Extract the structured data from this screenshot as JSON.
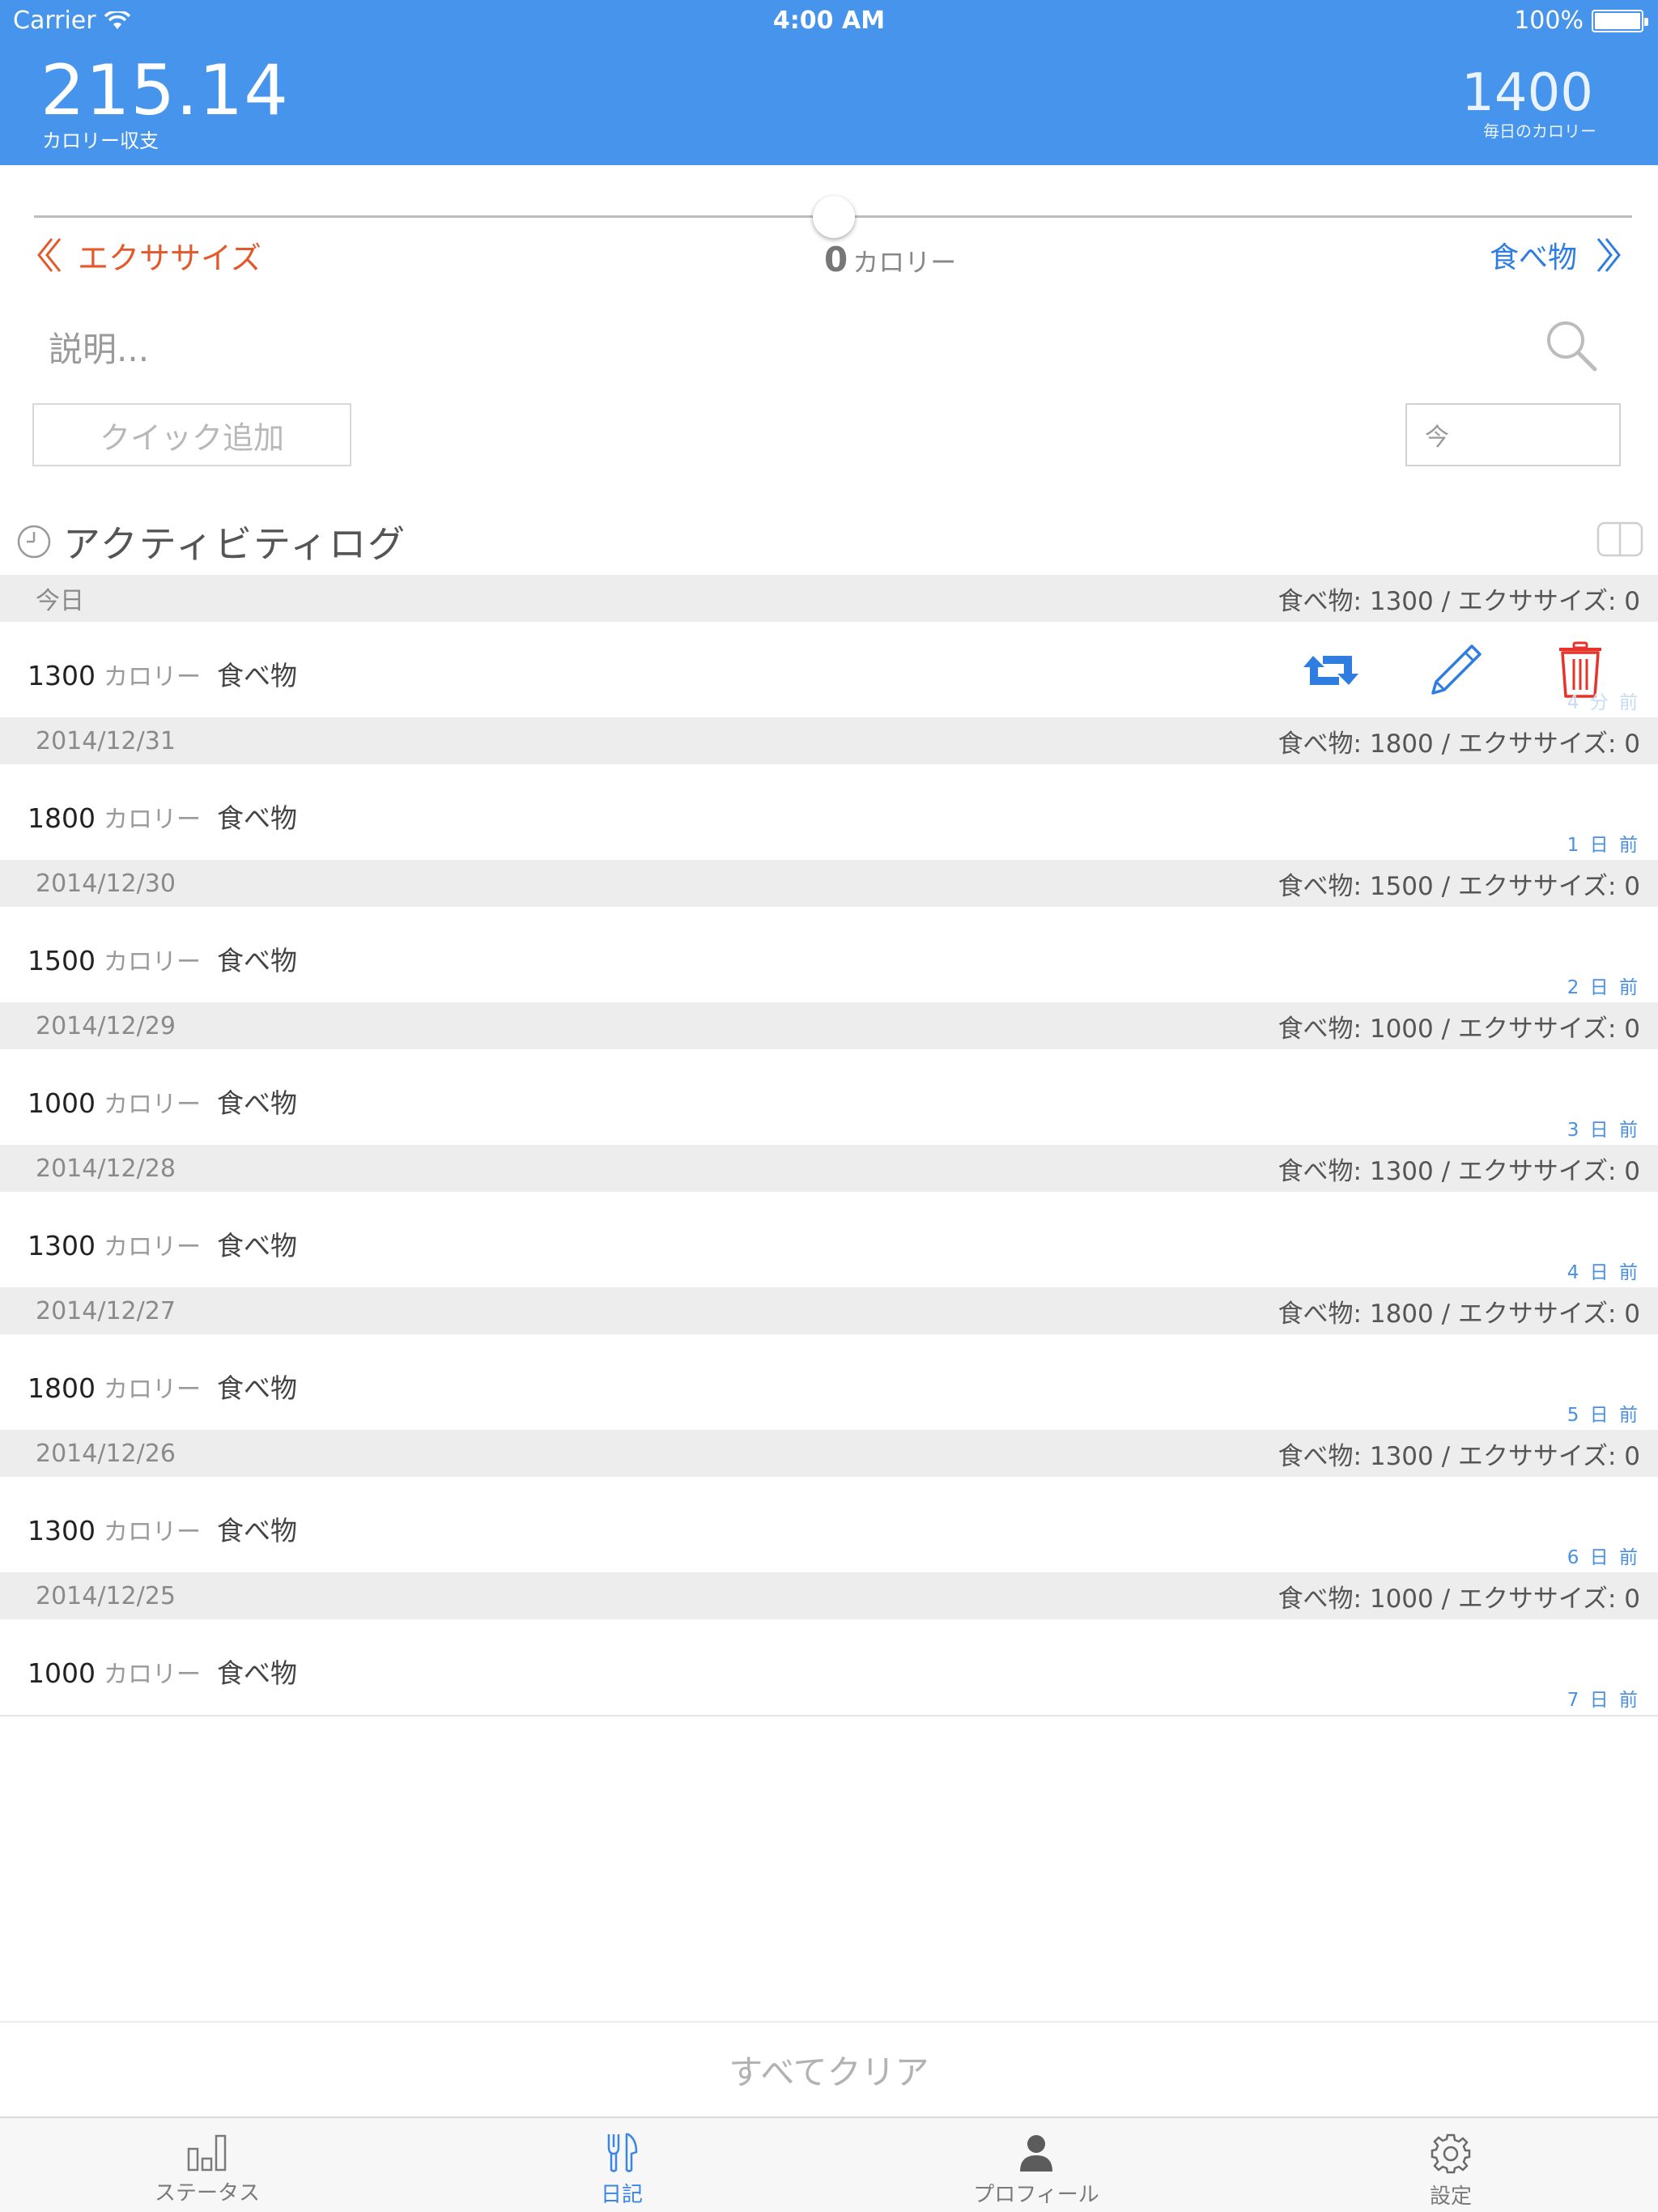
{
  "status_bar": {
    "carrier": "Carrier",
    "time": "4:00 AM",
    "battery": "100%"
  },
  "header": {
    "balance_value": "215.14",
    "balance_label": "カロリー収支",
    "daily_value": "1400",
    "daily_label": "毎日のカロリー",
    "background_color": "#4694ec"
  },
  "slider": {
    "left_label": "エクササイズ",
    "right_label": "食べ物",
    "calories_value": "0",
    "calories_unit": "カロリー",
    "left_color": "#e4582b",
    "right_color": "#2f7de1"
  },
  "search": {
    "placeholder": "説明...",
    "icon": "search-icon"
  },
  "quick_add": {
    "label": "クイック追加"
  },
  "time_field": {
    "placeholder": "今"
  },
  "activity_log": {
    "title": "アクティビティログ",
    "days": [
      {
        "date": "今日",
        "summary": "食べ物: 1300 / エクササイズ: 0",
        "entry": {
          "value": "1300",
          "unit": "カロリー",
          "type": "食べ物",
          "ago": "4 分 前"
        }
      },
      {
        "date": "2014/12/31",
        "summary": "食べ物: 1800 / エクササイズ: 0",
        "entry": {
          "value": "1800",
          "unit": "カロリー",
          "type": "食べ物",
          "ago": "1 日 前"
        }
      },
      {
        "date": "2014/12/30",
        "summary": "食べ物: 1500 / エクササイズ: 0",
        "entry": {
          "value": "1500",
          "unit": "カロリー",
          "type": "食べ物",
          "ago": "2 日 前"
        }
      },
      {
        "date": "2014/12/29",
        "summary": "食べ物: 1000 / エクササイズ: 0",
        "entry": {
          "value": "1000",
          "unit": "カロリー",
          "type": "食べ物",
          "ago": "3 日 前"
        }
      },
      {
        "date": "2014/12/28",
        "summary": "食べ物: 1300 / エクササイズ: 0",
        "entry": {
          "value": "1300",
          "unit": "カロリー",
          "type": "食べ物",
          "ago": "4 日 前"
        }
      },
      {
        "date": "2014/12/27",
        "summary": "食べ物: 1800 / エクササイズ: 0",
        "entry": {
          "value": "1800",
          "unit": "カロリー",
          "type": "食べ物",
          "ago": "5 日 前"
        }
      },
      {
        "date": "2014/12/26",
        "summary": "食べ物: 1300 / エクササイズ: 0",
        "entry": {
          "value": "1300",
          "unit": "カロリー",
          "type": "食べ物",
          "ago": "6 日 前"
        }
      },
      {
        "date": "2014/12/25",
        "summary": "食べ物: 1000 / エクササイズ: 0",
        "entry": {
          "value": "1000",
          "unit": "カロリー",
          "type": "食べ物",
          "ago": "7 日 前"
        }
      }
    ],
    "actions": {
      "repeat_icon": "repeat-icon",
      "edit_icon": "pencil-icon",
      "delete_icon": "trash-icon",
      "delete_color": "#e8322c",
      "accent_color": "#2f7de1"
    }
  },
  "clear_all": {
    "label": "すべてクリア"
  },
  "tab_bar": {
    "tabs": [
      {
        "label": "ステータス",
        "icon": "bar-chart-icon",
        "active": false
      },
      {
        "label": "日記",
        "icon": "utensils-icon",
        "active": true
      },
      {
        "label": "プロフィール",
        "icon": "person-icon",
        "active": false
      },
      {
        "label": "設定",
        "icon": "gear-icon",
        "active": false
      }
    ],
    "active_color": "#3a86e6"
  }
}
